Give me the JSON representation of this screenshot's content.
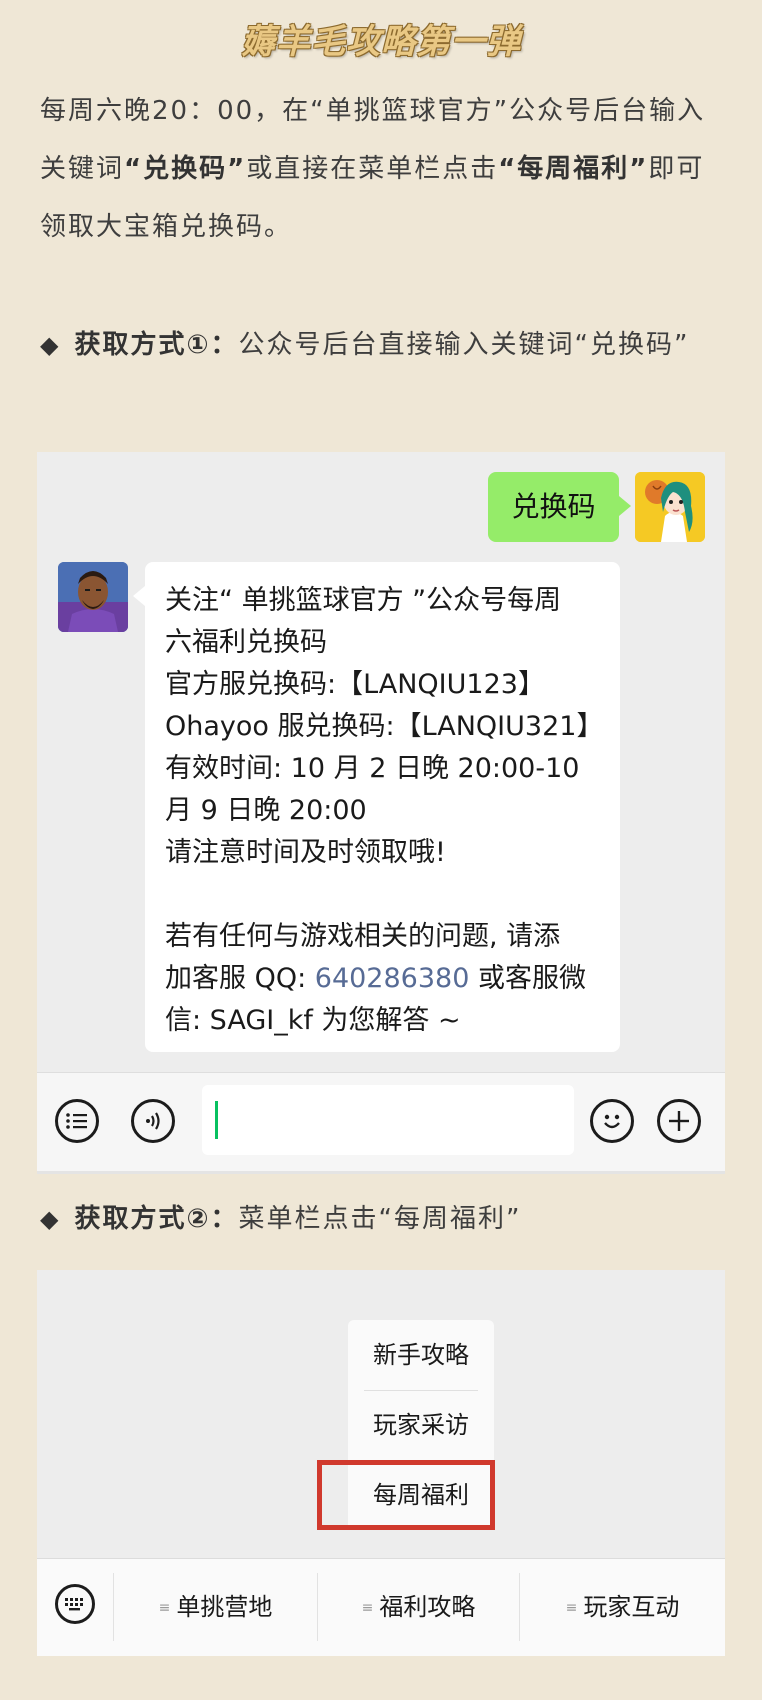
{
  "article": {
    "title": "薅羊毛攻略第一弹",
    "intro_part1": "每周六晚20：00，在“单挑篮球官方”公众号后台输入关键词",
    "intro_bold1": "“兑换码”",
    "intro_part2": "或直接在菜单栏点击",
    "intro_bold2": "“每周福利”",
    "intro_part3": "即可领取大宝箱兑换码。"
  },
  "method1": {
    "diamond": "◆",
    "label": "获取方式①：",
    "text": "公众号后台直接输入关键词“兑换码”"
  },
  "method2": {
    "diamond": "◆",
    "label": "获取方式②：",
    "text": "菜单栏点击“每周福利”"
  },
  "chat": {
    "user_message": "兑换码",
    "reply_lines": [
      "关注“ 单挑篮球官方 ”公众号每周",
      "六福利兑换码",
      "官方服兑换码:【LANQIU123】",
      "Ohayoo 服兑换码:【LANQIU321】",
      "有效时间: 10 月 2 日晚 20:00-10",
      "月 9 日晚 20:00",
      "请注意时间及时领取哦!"
    ],
    "reply_support_1": "若有任何与游戏相关的问题, 请添",
    "reply_support_2a": "加客服 QQ: ",
    "reply_support_qq": "640286380",
    "reply_support_2b": " 或客服微",
    "reply_support_3": "信: SAGI_kf 为您解答 ~",
    "input_value": ""
  },
  "menu": {
    "submenu_items": [
      "新手攻略",
      "玩家采访",
      "每周福利"
    ],
    "tabs": [
      "单挑营地",
      "福利攻略",
      "玩家互动"
    ],
    "tab_icon": "≡"
  },
  "colors": {
    "page_bg": "#efe7d6",
    "user_bubble": "#95ec69",
    "link": "#576b95",
    "highlight": "#d0392d"
  }
}
